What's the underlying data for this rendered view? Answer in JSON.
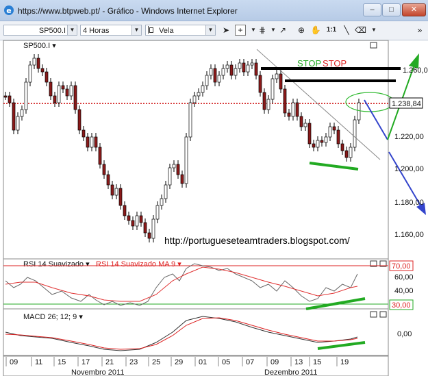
{
  "window": {
    "title": "https://www.btpweb.pt/ - Gráfico - Windows Internet Explorer",
    "minimize_label": "–",
    "maximize_label": "□",
    "close_label": "✕"
  },
  "toolbar": {
    "symbol": "SP500.I",
    "timeframe": "4 Horas",
    "chart_style": "Vela",
    "icons": [
      "cursor-icon",
      "crosshair-icon",
      "dropdown-icon",
      "grid-icon",
      "dropdown-icon",
      "arrow-icon",
      "zoom-icon",
      "hand-icon",
      "ratio-icon",
      "line-icon",
      "eraser-icon",
      "dropdown-icon",
      "more-icon"
    ],
    "ratio_label": "1:1"
  },
  "main_panel": {
    "symbol_label": "SP500.I ▾",
    "price_axis": [
      "1.260,00",
      "1.220,00",
      "1.200,00",
      "1.180,00",
      "1.160,00"
    ],
    "current_price": "1.238,84",
    "stop_label_1": "STOP",
    "stop_label_2": "STOP",
    "watermark": "http://portugueseteamtraders.blogspot.com/"
  },
  "rsi_panel": {
    "label": "RSI 14 Suavizado ▾",
    "label_ma": "RSI 14 Suavizado MA 9 ▾",
    "axis": [
      "70,00",
      "60,00",
      "40,00",
      "30,00"
    ]
  },
  "macd_panel": {
    "label": "MACD 26; 12; 9 ▾",
    "axis": [
      "0,00"
    ]
  },
  "time_axis": {
    "days": [
      "09",
      "11",
      "15",
      "17",
      "21",
      "23",
      "25",
      "29",
      "01",
      "05",
      "07",
      "09",
      "13",
      "15",
      "19"
    ],
    "months": [
      "Novembro 2011",
      "Dezembro 2011"
    ]
  },
  "colors": {
    "candle": "#000000",
    "candle_bear": "#b22222",
    "dotted_level": "#cc0000",
    "green_annotation": "#22aa22",
    "blue_annotation": "#3344cc",
    "rsi_line": "#666666",
    "rsi_ma": "#e03030",
    "macd": "#333333",
    "macd_signal": "#dd2222"
  }
}
